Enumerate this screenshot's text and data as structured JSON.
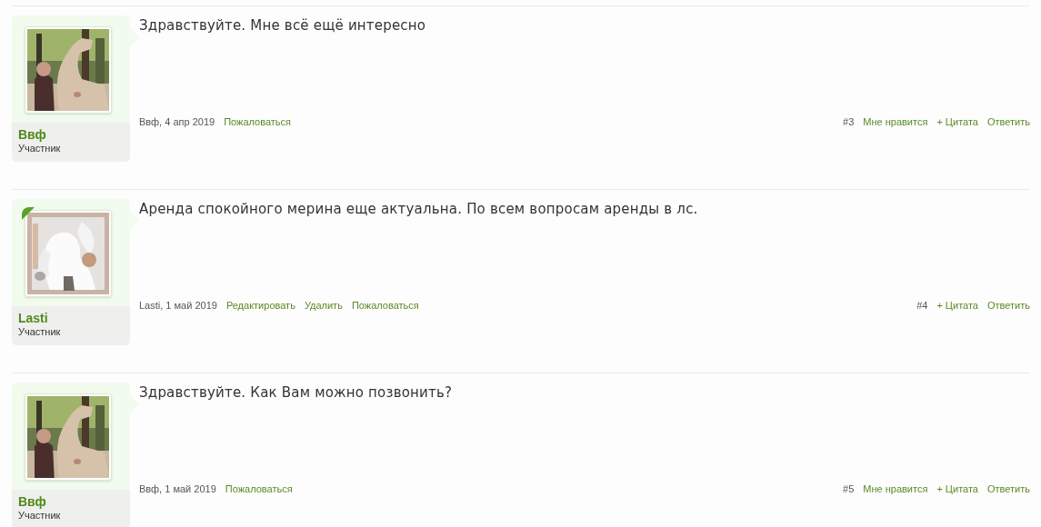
{
  "posts": [
    {
      "author": "Ввф",
      "role": "Участник",
      "avatar": {
        "kind": "picture"
      },
      "marked": false,
      "message": "Здравствуйте. Мне всё ещё интересно",
      "byline": "Ввф, 4 апр 2019",
      "actions_left": [
        "Пожаловаться"
      ],
      "number": "#3",
      "actions_right": [
        "Мне нравится",
        "+ Цитата",
        "Ответить"
      ]
    },
    {
      "author": "Lasti",
      "role": "Участник",
      "avatar": {
        "kind": "picture"
      },
      "marked": true,
      "message": "Аренда спокойного мерина еще актуальна. По всем вопросам аренды в лс.",
      "byline": "Lasti, 1 май 2019",
      "actions_left": [
        "Редактировать",
        "Удалить",
        "Пожаловаться"
      ],
      "number": "#4",
      "actions_right": [
        "+ Цитата",
        "Ответить"
      ]
    },
    {
      "author": "Ввф",
      "role": "Участник",
      "avatar": {
        "kind": "picture"
      },
      "marked": false,
      "message": "Здравствуйте. Как Вам можно позвонить?",
      "byline": "Ввф, 1 май 2019",
      "actions_left": [
        "Пожаловаться"
      ],
      "number": "#5",
      "actions_right": [
        "Мне нравится",
        "+ Цитата",
        "Ответить"
      ]
    }
  ]
}
